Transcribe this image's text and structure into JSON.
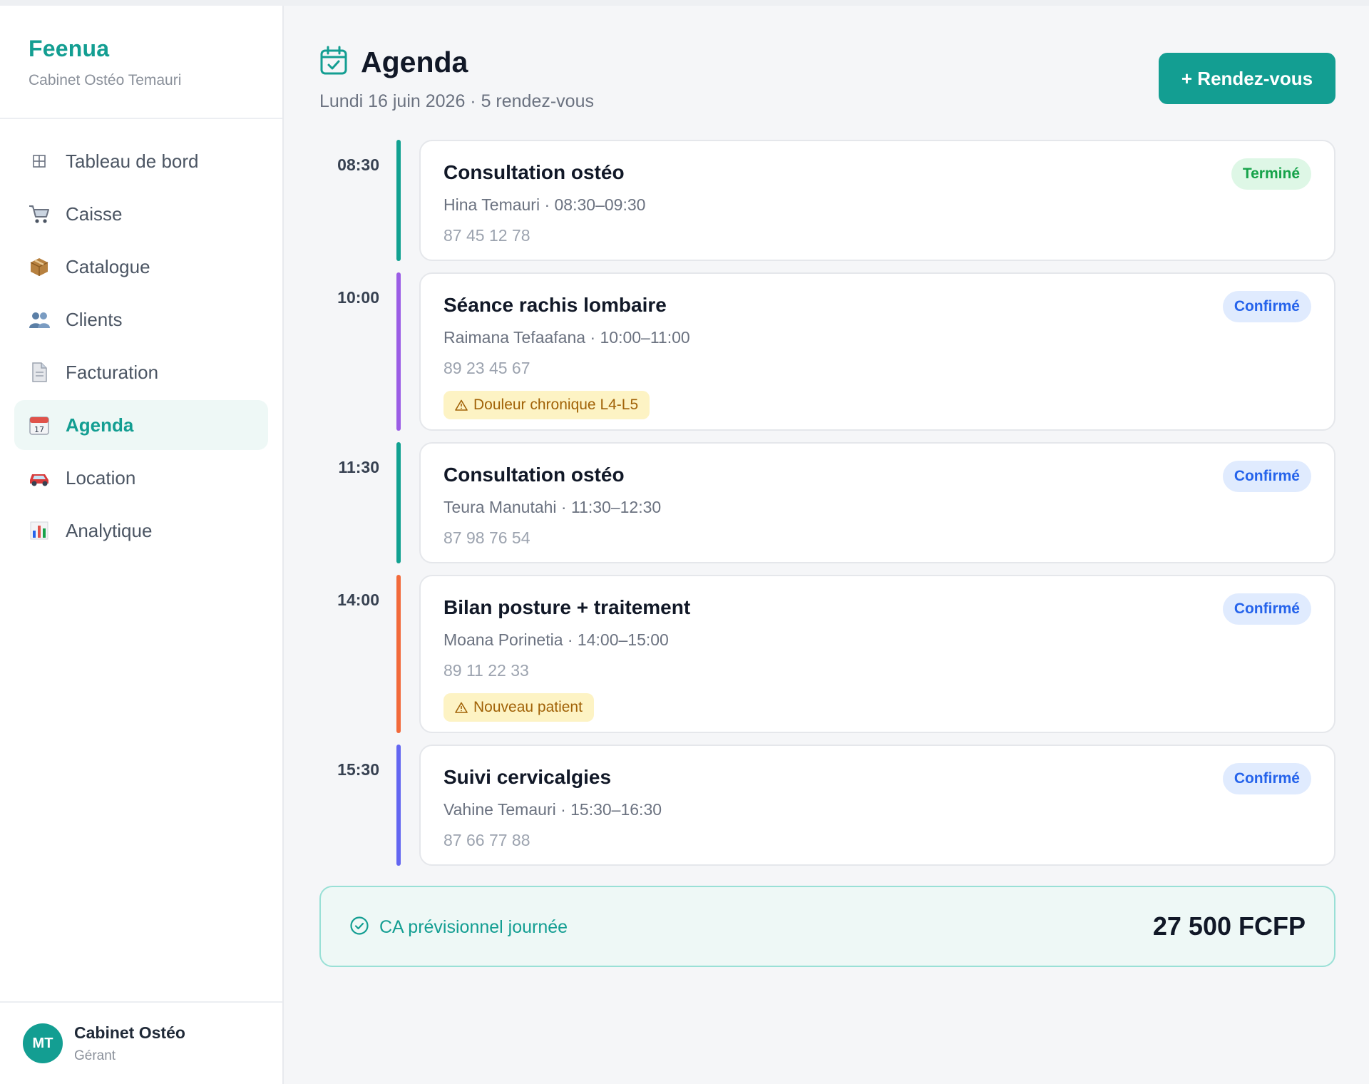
{
  "brand": {
    "name": "Feenua",
    "subtitle": "Cabinet Ostéo Temauri"
  },
  "nav": [
    {
      "label": "Tableau de bord",
      "icon": "grid-icon"
    },
    {
      "label": "Caisse",
      "icon": "cart-icon"
    },
    {
      "label": "Catalogue",
      "icon": "package-icon"
    },
    {
      "label": "Clients",
      "icon": "users-icon"
    },
    {
      "label": "Facturation",
      "icon": "document-icon"
    },
    {
      "label": "Agenda",
      "icon": "calendar-icon",
      "active": true
    },
    {
      "label": "Location",
      "icon": "car-icon"
    },
    {
      "label": "Analytique",
      "icon": "bar-chart-icon"
    }
  ],
  "user": {
    "initials": "MT",
    "name": "Cabinet Ostéo",
    "role": "Gérant"
  },
  "header": {
    "title": "Agenda",
    "subtitle": "Lundi 16 juin 2026 · 5 rendez-vous",
    "add_button": "+ Rendez-vous"
  },
  "appointments": [
    {
      "time": "08:30",
      "title": "Consultation ostéo",
      "meta": "Hina Temauri · 08:30–09:30",
      "phone": "87 45 12 78",
      "status": "Terminé",
      "status_type": "done",
      "bar_color": "#12a191",
      "alert": ""
    },
    {
      "time": "10:00",
      "title": "Séance rachis lombaire",
      "meta": "Raimana Tefaafana · 10:00–11:00",
      "phone": "89 23 45 67",
      "status": "Confirmé",
      "status_type": "confirmed",
      "bar_color": "#9b5de5",
      "alert": "Douleur chronique L4-L5"
    },
    {
      "time": "11:30",
      "title": "Consultation ostéo",
      "meta": "Teura Manutahi · 11:30–12:30",
      "phone": "87 98 76 54",
      "status": "Confirmé",
      "status_type": "confirmed",
      "bar_color": "#12a191",
      "alert": ""
    },
    {
      "time": "14:00",
      "title": "Bilan posture + traitement",
      "meta": "Moana Porinetia · 14:00–15:00",
      "phone": "89 11 22 33",
      "status": "Confirmé",
      "status_type": "confirmed",
      "bar_color": "#f26a3b",
      "alert": "Nouveau patient"
    },
    {
      "time": "15:30",
      "title": "Suivi cervicalgies",
      "meta": "Vahine Temauri · 15:30–16:30",
      "phone": "87 66 77 88",
      "status": "Confirmé",
      "status_type": "confirmed",
      "bar_color": "#6366f1",
      "alert": ""
    }
  ],
  "summary": {
    "label": "CA prévisionnel journée",
    "value": "27 500 FCFP"
  },
  "colors": {
    "accent": "#139e92"
  }
}
